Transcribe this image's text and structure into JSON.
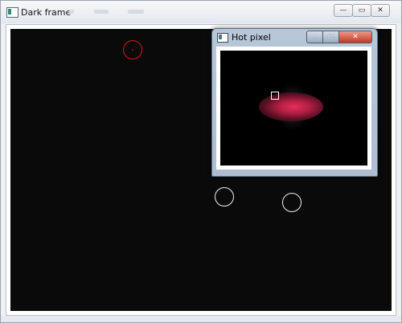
{
  "main_window": {
    "title": "Dark frame",
    "buttons": {
      "minimize": "—",
      "restore": "▭",
      "close": "✕"
    }
  },
  "inset_window": {
    "title": "Hot pixel",
    "buttons": {
      "minimize": "–",
      "maximize": "▭",
      "close": "✕"
    }
  },
  "colors": {
    "canvas_bg": "#0a0a0a",
    "red_marker": "#d11a1a",
    "white_marker": "#f2f2f2",
    "hot_pixel": "#e0305a"
  },
  "icons": {
    "app": "window-app-icon",
    "inset_app": "window-app-icon"
  }
}
